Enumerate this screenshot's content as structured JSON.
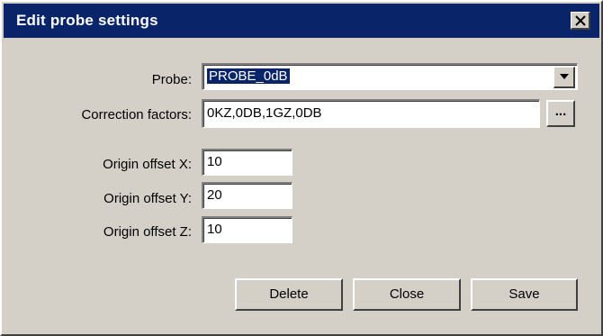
{
  "window": {
    "title": "Edit probe settings",
    "close_icon": "close-icon"
  },
  "form": {
    "probe_label": "Probe:",
    "probe_value": "PROBE_0dB",
    "correction_label": "Correction factors:",
    "correction_value": "0KZ,0DB,1GZ,0DB",
    "browse_label": "...",
    "offset_x_label": "Origin offset X:",
    "offset_x_value": "10",
    "offset_y_label": "Origin offset Y:",
    "offset_y_value": "20",
    "offset_z_label": "Origin offset Z:",
    "offset_z_value": "10"
  },
  "buttons": {
    "delete_label": "Delete",
    "close_label": "Close",
    "save_label": "Save"
  },
  "colors": {
    "titlebar": "#0a246a",
    "dialog_bg": "#d4d0c8",
    "selection": "#0a246a"
  }
}
